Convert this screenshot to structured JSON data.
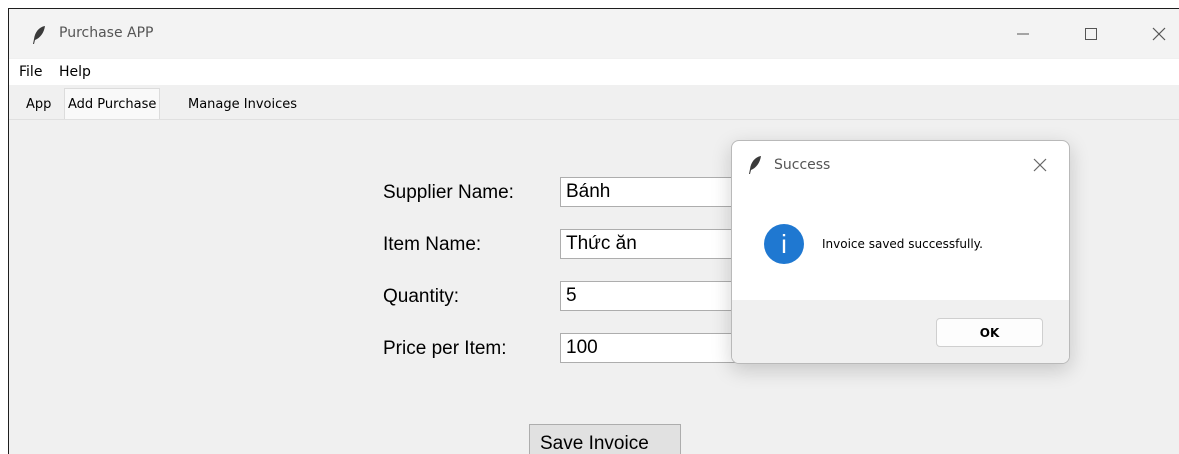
{
  "window": {
    "title": "Purchase APP",
    "icon": "feather-icon"
  },
  "menu": {
    "items": [
      "File",
      "Help"
    ]
  },
  "tabs": [
    {
      "label": "App",
      "active": false
    },
    {
      "label": "Add Purchase",
      "active": true
    },
    {
      "label": "Manage Invoices",
      "active": false
    }
  ],
  "form": {
    "supplier_label": "Supplier Name:",
    "supplier_value": "Bánh",
    "item_label": "Item Name:",
    "item_value": "Thức ăn",
    "quantity_label": "Quantity:",
    "quantity_value": "5",
    "price_label": "Price per Item:",
    "price_value": "100",
    "save_label": "Save Invoice"
  },
  "dialog": {
    "title": "Success",
    "message": "Invoice saved successfully.",
    "ok_label": "OK",
    "icon": "info-icon",
    "accent": "#1f78d1"
  }
}
